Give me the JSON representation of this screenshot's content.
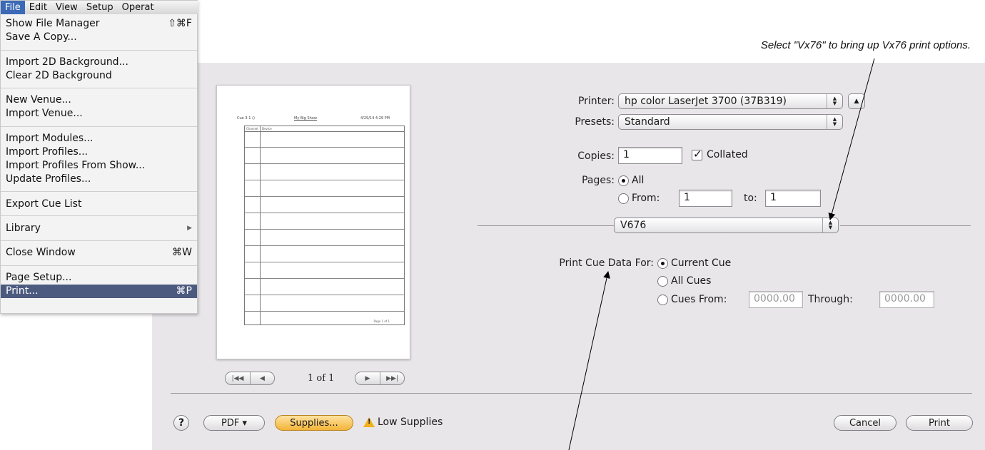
{
  "callout": "Select \"Vx76\" to bring up Vx76 print options.",
  "menu": {
    "bar": [
      "File",
      "Edit",
      "View",
      "Setup",
      "Operat"
    ],
    "items": [
      {
        "label": "Show File Manager",
        "shortcut": "⇧⌘F"
      },
      {
        "label": "Save A Copy..."
      },
      {
        "label": "Import 2D Background..."
      },
      {
        "label": "Clear 2D Background"
      },
      {
        "label": "New Venue..."
      },
      {
        "label": "Import Venue..."
      },
      {
        "label": "Import Modules..."
      },
      {
        "label": "Import Profiles..."
      },
      {
        "label": "Import Profiles From Show..."
      },
      {
        "label": "Update Profiles..."
      },
      {
        "label": "Export Cue List"
      },
      {
        "label": "Library",
        "submenu": "▶"
      },
      {
        "label": "Close Window",
        "shortcut": "⌘W"
      },
      {
        "label": "Page Setup..."
      },
      {
        "label": "Print...",
        "shortcut": "⌘P"
      }
    ]
  },
  "preview": {
    "header_left": "Cue 3-1 ()",
    "header_center": "My Big Show",
    "header_right": "4/29/14 4:29 PM",
    "col1": "Channel",
    "col2": "Device",
    "footer": "Page 1 of 1",
    "page_count": "1 of 1",
    "nav_left": [
      "|◀◀",
      "◀"
    ],
    "nav_right": [
      "▶",
      "▶▶|"
    ]
  },
  "printer": {
    "label": "Printer:",
    "value": "hp color LaserJet 3700 (37B319)",
    "expand": "▲"
  },
  "presets": {
    "label": "Presets:",
    "value": "Standard"
  },
  "copies": {
    "label": "Copies:",
    "value": "1",
    "collated_label": "Collated",
    "collated": true
  },
  "pages": {
    "label": "Pages:",
    "all_label": "All",
    "from_label": "From:",
    "from_value": "1",
    "to_label": "to:",
    "to_value": "1",
    "selected": "All"
  },
  "panel_select": {
    "value": "V676"
  },
  "cue_data": {
    "label": "Print Cue Data For:",
    "current_cue": "Current Cue",
    "all_cues": "All Cues",
    "cues_from": "Cues From:",
    "from_value": "0000.00",
    "through_label": "Through:",
    "through_value": "0000.00",
    "selected": "Current Cue"
  },
  "footer": {
    "help": "?",
    "pdf": "PDF ▾",
    "supplies": "Supplies...",
    "low_supplies": "Low Supplies",
    "cancel": "Cancel",
    "print": "Print"
  },
  "stepper_up": "▲",
  "stepper_down": "▼"
}
